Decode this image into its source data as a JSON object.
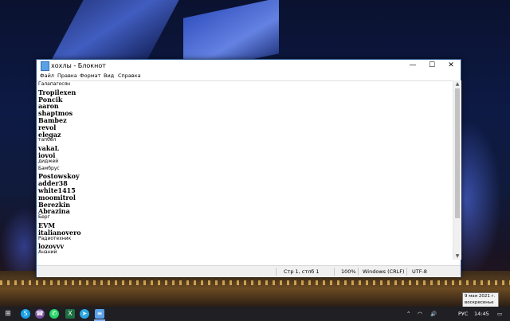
{
  "window": {
    "title": "хохлы - Блокнот",
    "minimize": "—",
    "maximize": "☐",
    "close": "✕"
  },
  "menu": [
    "Файл",
    "Правка",
    "Формат",
    "Вид",
    "Справка"
  ],
  "lines": [
    {
      "text": "Галапагосян",
      "style": "plain"
    },
    {
      "text": "Tropilexen",
      "style": "bold"
    },
    {
      "text": "Poncik",
      "style": "bold"
    },
    {
      "text": "aaron",
      "style": "bold"
    },
    {
      "text": "shaptmos",
      "style": "bold"
    },
    {
      "text": "Bambez",
      "style": "bold"
    },
    {
      "text": "revol",
      "style": "bold"
    },
    {
      "text": "elegaz",
      "style": "bold"
    },
    {
      "text": "тапбел",
      "style": "plain"
    },
    {
      "text": "vakaL",
      "style": "bold"
    },
    {
      "text": "iovoi",
      "style": "bold"
    },
    {
      "text": "диджей",
      "style": "plain"
    },
    {
      "text": "Бамбрус",
      "style": "plain"
    },
    {
      "text": "Postowskoy",
      "style": "bold"
    },
    {
      "text": "adder38",
      "style": "bold"
    },
    {
      "text": "white1415",
      "style": "bold"
    },
    {
      "text": "moomitrol",
      "style": "bold"
    },
    {
      "text": "Berezkin",
      "style": "bold"
    },
    {
      "text": "Abrazina",
      "style": "bold"
    },
    {
      "text": "Берг",
      "style": "plain"
    },
    {
      "text": "EVM",
      "style": "bold"
    },
    {
      "text": "italianovero",
      "style": "bold"
    },
    {
      "text": "Радиотехник",
      "style": "plain"
    },
    {
      "text": "lozovvv",
      "style": "bold"
    },
    {
      "text": "Ананий",
      "style": "plain"
    }
  ],
  "status": {
    "position": "Стр 1, стлб 1",
    "zoom": "100%",
    "line_endings": "Windows (CRLF)",
    "encoding": "UTF-8"
  },
  "taskbar": {
    "icons": [
      "windows-start-icon",
      "skype-icon",
      "viber-icon",
      "whatsapp-icon",
      "excel-icon",
      "telegram-icon",
      "notepad-icon"
    ],
    "language": "РУС",
    "time": "14:45"
  },
  "tooltip": {
    "date": "9 мая 2021 г.",
    "day": "воскресенье"
  },
  "colors": {
    "accent": "#2b5797",
    "taskbar": "#1f1f24"
  }
}
